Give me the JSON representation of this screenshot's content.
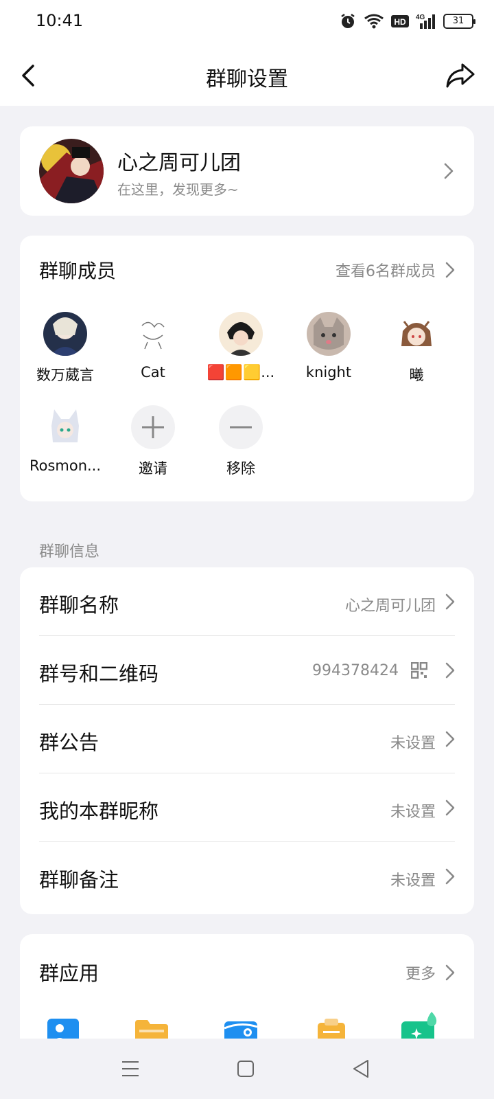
{
  "status": {
    "time": "10:41",
    "hd_label": "HD",
    "network_label": "4G",
    "battery": "31"
  },
  "header": {
    "title": "群聊设置"
  },
  "group": {
    "name": "心之周可儿团",
    "subtitle": "在这里，发现更多~"
  },
  "members": {
    "title": "群聊成员",
    "view_all": "查看6名群成员",
    "list": [
      {
        "name": "数万葳言"
      },
      {
        "name": "Cat"
      },
      {
        "name": "🟥🟧🟨..."
      },
      {
        "name": "knight"
      },
      {
        "name": "曦"
      },
      {
        "name": "Rosmon..."
      }
    ],
    "invite_label": "邀请",
    "remove_label": "移除"
  },
  "info": {
    "section_title": "群聊信息",
    "rows": [
      {
        "label": "群聊名称",
        "value": "心之周可儿团"
      },
      {
        "label": "群号和二维码",
        "value": "994378424"
      },
      {
        "label": "群公告",
        "value": "未设置"
      },
      {
        "label": "我的本群昵称",
        "value": "未设置"
      },
      {
        "label": "群聊备注",
        "value": "未设置"
      }
    ]
  },
  "apps": {
    "title": "群应用",
    "more": "更多",
    "icons": [
      "group-album-icon",
      "group-file-icon",
      "group-camera-icon",
      "group-clipboard-icon",
      "group-magic-icon"
    ]
  },
  "colors": {
    "accent_blue": "#1e8ff0",
    "accent_orange": "#f5b43a",
    "accent_green": "#17c38b"
  }
}
